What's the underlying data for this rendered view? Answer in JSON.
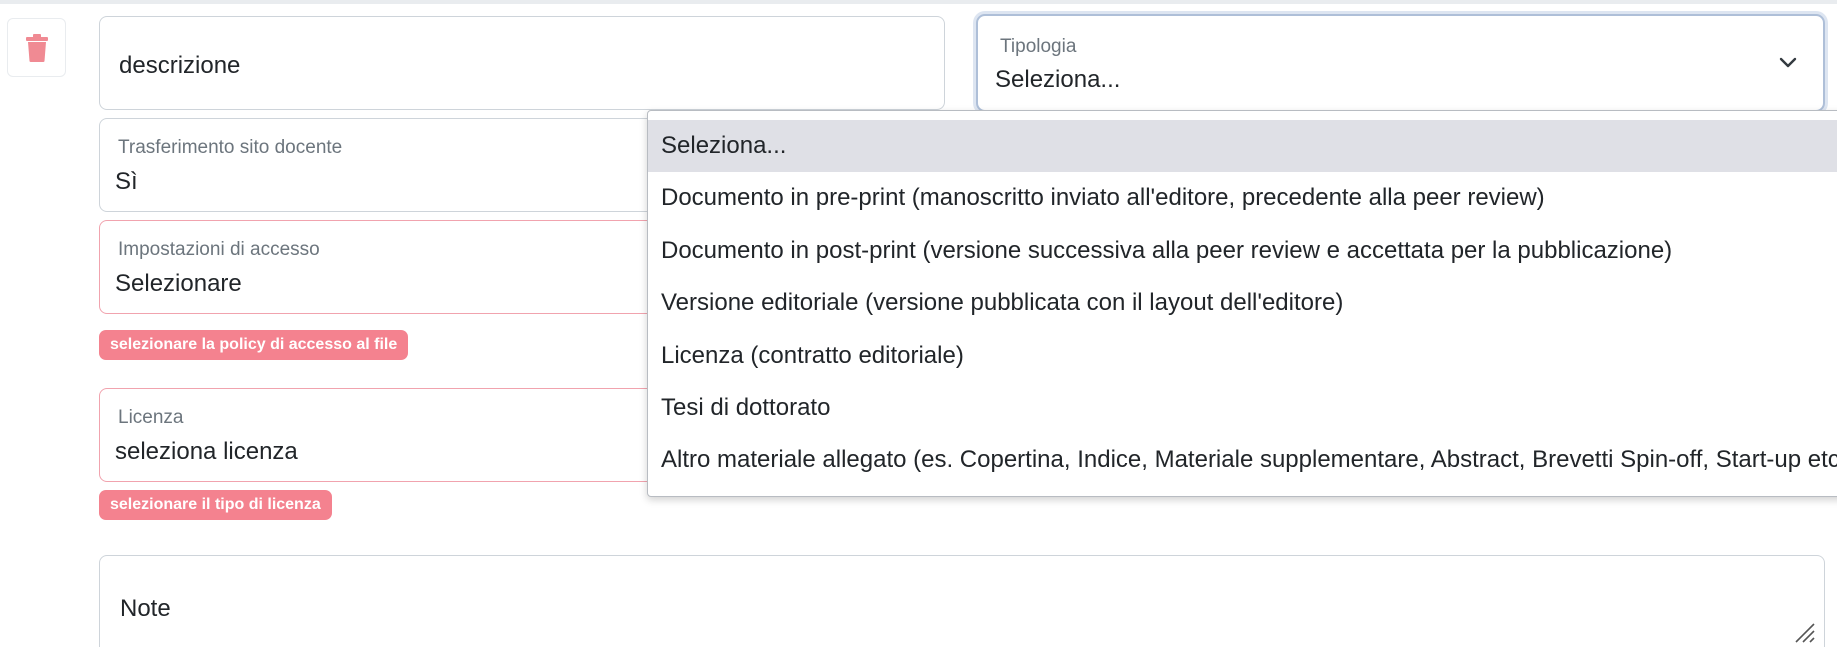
{
  "icons": {
    "delete": "trash-icon",
    "select_arrow": "chevron-down-icon",
    "resize": "resize-grip-icon"
  },
  "colors": {
    "delete_icon": "#f08a93",
    "error_badge_bg": "#f4828f",
    "invalid_border": "#f1a3ae",
    "focus_border": "#aebfd8",
    "selected_option_bg": "#dfe0e6"
  },
  "form": {
    "descrizione": {
      "value": "descrizione"
    },
    "tipologia": {
      "label": "Tipologia",
      "value": "Seleziona..."
    },
    "trasferimento": {
      "label": "Trasferimento sito docente",
      "value": "Sì"
    },
    "impostazioni": {
      "label": "Impostazioni di accesso",
      "value": "Selezionare",
      "error": "selezionare la policy di accesso al file"
    },
    "licenza": {
      "label": "Licenza",
      "value": "seleziona licenza",
      "error": "selezionare il tipo di licenza"
    },
    "note": {
      "value": "Note"
    }
  },
  "dropdown": {
    "options": [
      {
        "label": "Seleziona...",
        "selected": true
      },
      {
        "label": "Documento in pre-print (manoscritto inviato all'editore, precedente alla peer review)",
        "selected": false
      },
      {
        "label": "Documento in post-print (versione successiva alla peer review e accettata per la pubblicazione)",
        "selected": false
      },
      {
        "label": "Versione editoriale (versione pubblicata con il layout dell'editore)",
        "selected": false
      },
      {
        "label": "Licenza (contratto editoriale)",
        "selected": false
      },
      {
        "label": "Tesi di dottorato",
        "selected": false
      },
      {
        "label": "Altro materiale allegato (es. Copertina, Indice, Materiale supplementare, Abstract, Brevetti Spin-off, Start-up etc.)",
        "selected": false
      }
    ]
  }
}
